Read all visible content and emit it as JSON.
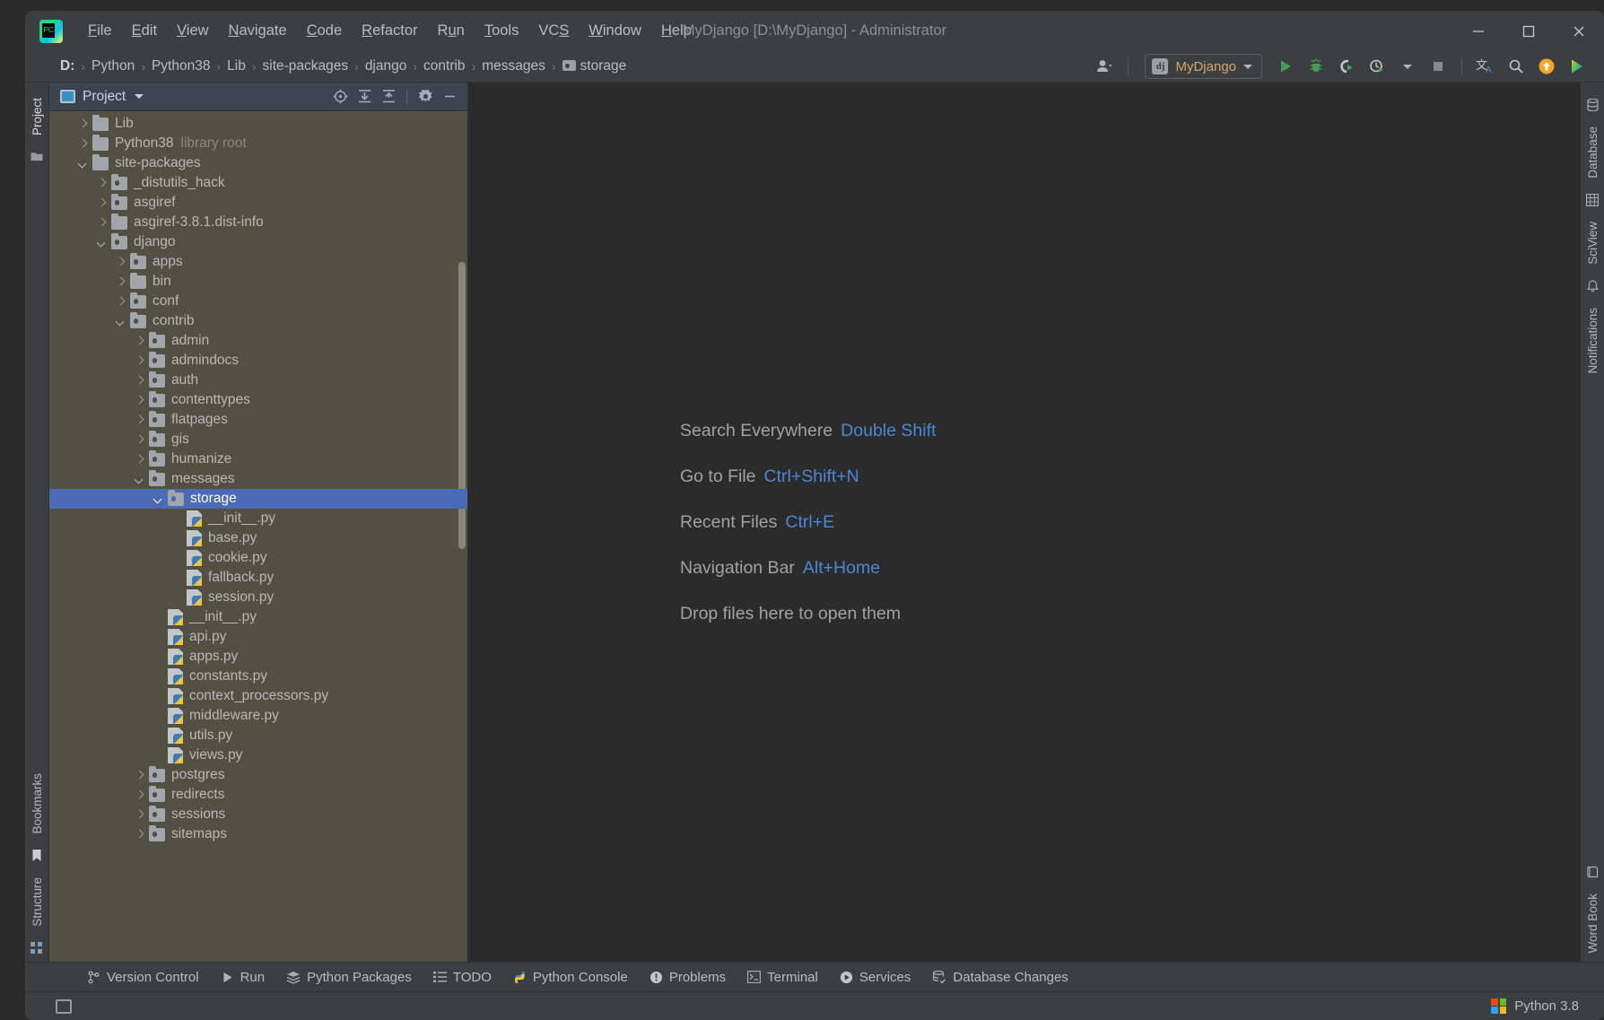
{
  "window": {
    "title": "MyDjango [D:\\MyDjango] - Administrator",
    "minimize_label": "—",
    "maximize_label": "☐",
    "close_label": "✕"
  },
  "menubar": {
    "items": [
      {
        "label": "File",
        "mnemonic": "F"
      },
      {
        "label": "Edit",
        "mnemonic": "E"
      },
      {
        "label": "View",
        "mnemonic": "V"
      },
      {
        "label": "Navigate",
        "mnemonic": "N"
      },
      {
        "label": "Code",
        "mnemonic": "C"
      },
      {
        "label": "Refactor",
        "mnemonic": "R"
      },
      {
        "label": "Run",
        "mnemonic": "u"
      },
      {
        "label": "Tools",
        "mnemonic": "T"
      },
      {
        "label": "VCS",
        "mnemonic": "S"
      },
      {
        "label": "Window",
        "mnemonic": "W"
      },
      {
        "label": "Help",
        "mnemonic": "H"
      }
    ]
  },
  "navbar": {
    "crumbs": [
      "D:",
      "Python",
      "Python38",
      "Lib",
      "site-packages",
      "django",
      "contrib",
      "messages",
      "storage"
    ],
    "separator": "›",
    "run_config": "MyDjango",
    "icons": [
      "user-avatar-icon",
      "run-icon",
      "debug-icon",
      "coverage-icon",
      "profile-icon",
      "stop-icon",
      "translate-icon",
      "search-icon",
      "update-icon",
      "ide-feature-icon"
    ]
  },
  "left_stripe": {
    "top_tabs": [
      "Project"
    ],
    "bottom_tabs": [
      "Bookmarks",
      "Structure"
    ]
  },
  "right_stripe": {
    "tabs": [
      "Database",
      "SciView",
      "Notifications",
      "Word Book"
    ]
  },
  "project_panel": {
    "title": "Project",
    "actions": [
      "locate-icon",
      "expand-all-icon",
      "collapse-all-icon",
      "settings-gear-icon",
      "hide-icon"
    ],
    "tree": [
      {
        "label": "Lib",
        "indent": 1,
        "arrow": "right",
        "icon": "folder"
      },
      {
        "label": "Python38",
        "indent": 1,
        "arrow": "right",
        "icon": "folder",
        "suffix": "library root"
      },
      {
        "label": "site-packages",
        "indent": 1,
        "arrow": "down",
        "icon": "folder"
      },
      {
        "label": "_distutils_hack",
        "indent": 2,
        "arrow": "right",
        "icon": "package"
      },
      {
        "label": "asgiref",
        "indent": 2,
        "arrow": "right",
        "icon": "package"
      },
      {
        "label": "asgiref-3.8.1.dist-info",
        "indent": 2,
        "arrow": "right",
        "icon": "folder"
      },
      {
        "label": "django",
        "indent": 2,
        "arrow": "down",
        "icon": "package"
      },
      {
        "label": "apps",
        "indent": 3,
        "arrow": "right",
        "icon": "package"
      },
      {
        "label": "bin",
        "indent": 3,
        "arrow": "right",
        "icon": "folder"
      },
      {
        "label": "conf",
        "indent": 3,
        "arrow": "right",
        "icon": "package"
      },
      {
        "label": "contrib",
        "indent": 3,
        "arrow": "down",
        "icon": "package"
      },
      {
        "label": "admin",
        "indent": 4,
        "arrow": "right",
        "icon": "package"
      },
      {
        "label": "admindocs",
        "indent": 4,
        "arrow": "right",
        "icon": "package"
      },
      {
        "label": "auth",
        "indent": 4,
        "arrow": "right",
        "icon": "package"
      },
      {
        "label": "contenttypes",
        "indent": 4,
        "arrow": "right",
        "icon": "package"
      },
      {
        "label": "flatpages",
        "indent": 4,
        "arrow": "right",
        "icon": "package"
      },
      {
        "label": "gis",
        "indent": 4,
        "arrow": "right",
        "icon": "package"
      },
      {
        "label": "humanize",
        "indent": 4,
        "arrow": "right",
        "icon": "package"
      },
      {
        "label": "messages",
        "indent": 4,
        "arrow": "down",
        "icon": "package"
      },
      {
        "label": "storage",
        "indent": 5,
        "arrow": "down",
        "icon": "package",
        "selected": true
      },
      {
        "label": "__init__.py",
        "indent": 6,
        "arrow": "none",
        "icon": "python"
      },
      {
        "label": "base.py",
        "indent": 6,
        "arrow": "none",
        "icon": "python"
      },
      {
        "label": "cookie.py",
        "indent": 6,
        "arrow": "none",
        "icon": "python"
      },
      {
        "label": "fallback.py",
        "indent": 6,
        "arrow": "none",
        "icon": "python"
      },
      {
        "label": "session.py",
        "indent": 6,
        "arrow": "none",
        "icon": "python"
      },
      {
        "label": "__init__.py",
        "indent": 5,
        "arrow": "none",
        "icon": "python"
      },
      {
        "label": "api.py",
        "indent": 5,
        "arrow": "none",
        "icon": "python"
      },
      {
        "label": "apps.py",
        "indent": 5,
        "arrow": "none",
        "icon": "python"
      },
      {
        "label": "constants.py",
        "indent": 5,
        "arrow": "none",
        "icon": "python"
      },
      {
        "label": "context_processors.py",
        "indent": 5,
        "arrow": "none",
        "icon": "python"
      },
      {
        "label": "middleware.py",
        "indent": 5,
        "arrow": "none",
        "icon": "python"
      },
      {
        "label": "utils.py",
        "indent": 5,
        "arrow": "none",
        "icon": "python"
      },
      {
        "label": "views.py",
        "indent": 5,
        "arrow": "none",
        "icon": "python"
      },
      {
        "label": "postgres",
        "indent": 4,
        "arrow": "right",
        "icon": "package"
      },
      {
        "label": "redirects",
        "indent": 4,
        "arrow": "right",
        "icon": "package"
      },
      {
        "label": "sessions",
        "indent": 4,
        "arrow": "right",
        "icon": "package"
      },
      {
        "label": "sitemaps",
        "indent": 4,
        "arrow": "right",
        "icon": "package"
      }
    ]
  },
  "editor": {
    "hints": [
      {
        "text": "Search Everywhere",
        "key": "Double Shift"
      },
      {
        "text": "Go to File",
        "key": "Ctrl+Shift+N"
      },
      {
        "text": "Recent Files",
        "key": "Ctrl+E"
      },
      {
        "text": "Navigation Bar",
        "key": "Alt+Home"
      },
      {
        "text": "Drop files here to open them",
        "key": ""
      }
    ]
  },
  "bottombar": {
    "items": [
      {
        "label": "Version Control",
        "icon": "branch-icon"
      },
      {
        "label": "Run",
        "icon": "run-icon"
      },
      {
        "label": "Python Packages",
        "icon": "packages-icon"
      },
      {
        "label": "TODO",
        "icon": "todo-list-icon"
      },
      {
        "label": "Python Console",
        "icon": "python-console-icon"
      },
      {
        "label": "Problems",
        "icon": "problems-icon"
      },
      {
        "label": "Terminal",
        "icon": "terminal-icon"
      },
      {
        "label": "Services",
        "icon": "services-icon"
      },
      {
        "label": "Database Changes",
        "icon": "database-changes-icon"
      }
    ]
  },
  "statusbar": {
    "interpreter": "Python 3.8",
    "left_icon": "layout-icon"
  },
  "colors": {
    "accent_blue": "#4a88d6",
    "selection": "#4a6ab5",
    "panel_bg": "#3c3f41",
    "tree_bg": "#544f43",
    "editor_bg": "#2b2b2b",
    "header_bg": "#3c4450",
    "run_config_text": "#d4a76a"
  }
}
